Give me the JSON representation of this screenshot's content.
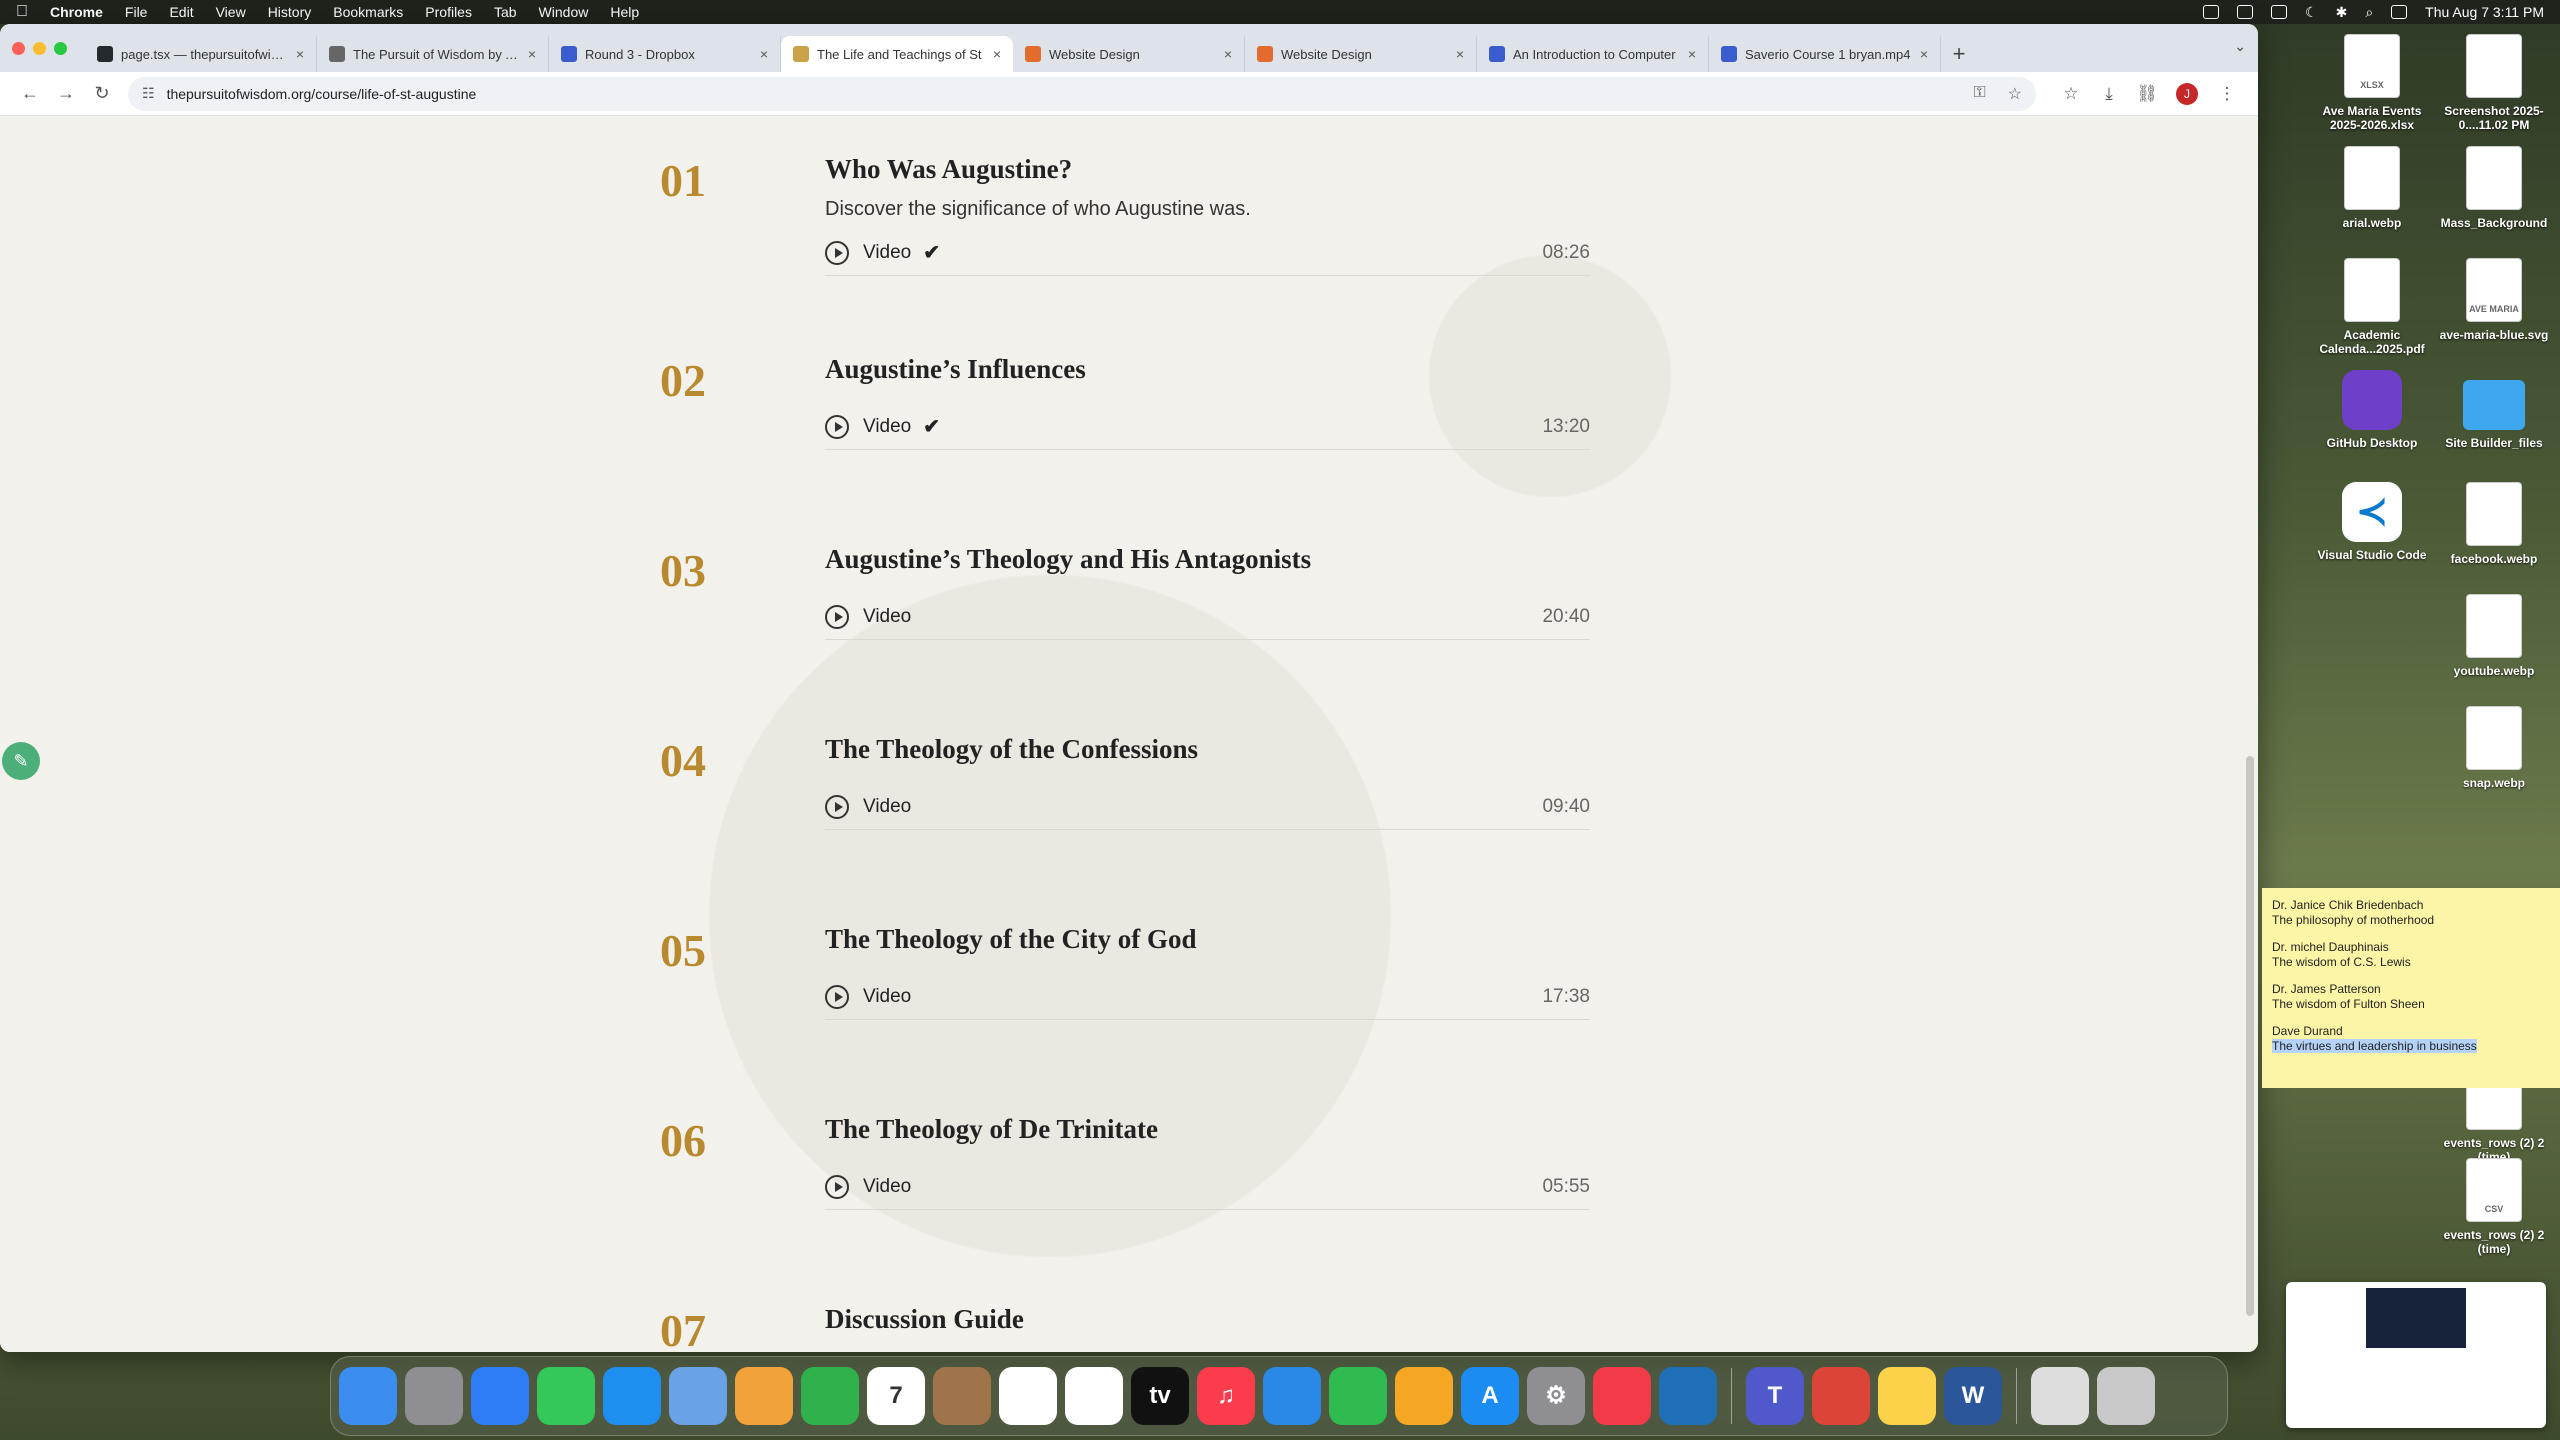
{
  "menubar": {
    "app": "Chrome",
    "items": [
      "File",
      "Edit",
      "View",
      "History",
      "Bookmarks",
      "Profiles",
      "Tab",
      "Window",
      "Help"
    ],
    "clock": "Thu Aug 7  3:11 PM"
  },
  "tabs": [
    {
      "label": "page.tsx — thepursuitofwisdom",
      "favicon": "github-icon",
      "color": "#24292e"
    },
    {
      "label": "The Pursuit of Wisdom by Ave",
      "favicon": "globe-icon",
      "color": "#666666"
    },
    {
      "label": "Round 3 - Dropbox",
      "favicon": "dropbox-icon",
      "color": "#3b5ccc"
    },
    {
      "label": "The Life and Teachings of St",
      "favicon": "site-icon",
      "color": "#c9a24a",
      "active": true
    },
    {
      "label": "Website Design",
      "favicon": "figma-icon",
      "color": "#e36b2d"
    },
    {
      "label": "Website Design",
      "favicon": "figma-icon",
      "color": "#e36b2d"
    },
    {
      "label": "An Introduction to Computer",
      "favicon": "dropbox-icon",
      "color": "#3b5ccc"
    },
    {
      "label": "Saverio Course 1 bryan.mp4",
      "favicon": "dropbox-icon",
      "color": "#3b5ccc"
    }
  ],
  "address": {
    "url": "thepursuitofwisdom.org/course/life-of-st-augustine"
  },
  "profile_initial": "J",
  "lessons": [
    {
      "num": "01",
      "title": "Who Was Augustine?",
      "desc": "Discover the significance of who Augustine was.",
      "type": "Video",
      "done": true,
      "duration": "08:26"
    },
    {
      "num": "02",
      "title": "Augustine’s Influences",
      "desc": "",
      "type": "Video",
      "done": true,
      "duration": "13:20"
    },
    {
      "num": "03",
      "title": "Augustine’s Theology and His Antagonists",
      "desc": "",
      "type": "Video",
      "done": false,
      "duration": "20:40"
    },
    {
      "num": "04",
      "title": "The Theology of the Confessions",
      "desc": "",
      "type": "Video",
      "done": false,
      "duration": "09:40"
    },
    {
      "num": "05",
      "title": "The Theology of the City of God",
      "desc": "",
      "type": "Video",
      "done": false,
      "duration": "17:38"
    },
    {
      "num": "06",
      "title": "The Theology of De Trinitate",
      "desc": "",
      "type": "Video",
      "done": false,
      "duration": "05:55"
    },
    {
      "num": "07",
      "title": "Discussion Guide",
      "desc": "",
      "type": "",
      "done": false,
      "duration": ""
    }
  ],
  "check_glyph": "✔",
  "desktop": [
    {
      "label": "Ave Maria Events 2025-2026.xlsx",
      "kind": "file",
      "badge": "XLSX"
    },
    {
      "label": "Screenshot 2025-0....11.02 PM",
      "kind": "file",
      "badge": ""
    },
    {
      "label": "arial.webp",
      "kind": "file",
      "badge": ""
    },
    {
      "label": "Mass_Background",
      "kind": "file",
      "badge": ""
    },
    {
      "label": "Academic Calenda...2025.pdf",
      "kind": "file",
      "badge": ""
    },
    {
      "label": "ave-maria-blue.svg",
      "kind": "file",
      "badge": "AVE MARIA"
    },
    {
      "label": "GitHub Desktop",
      "kind": "gh",
      "badge": ""
    },
    {
      "label": "Site Builder_files",
      "kind": "folder",
      "badge": ""
    },
    {
      "label": "Visual Studio Code",
      "kind": "vsc",
      "badge": ""
    },
    {
      "label": "facebook.webp",
      "kind": "file",
      "badge": ""
    },
    {
      "label": "youtube.webp",
      "kind": "file",
      "badge": ""
    },
    {
      "label": "snap.webp",
      "kind": "file",
      "badge": ""
    },
    {
      "label": "events_rows (2) 2 (time)",
      "kind": "file",
      "badge": ""
    },
    {
      "label": "events_rows (2) 2 (time)",
      "kind": "file",
      "badge": "CSV"
    }
  ],
  "sticky": [
    {
      "name": "Dr. Janice Chik Briedenbach",
      "topic": "The philosophy of motherhood",
      "highlight": false
    },
    {
      "name": "Dr. michel Dauphinais",
      "topic": "The wisdom of C.S. Lewis",
      "highlight": false
    },
    {
      "name": "Dr. James Patterson",
      "topic": "The wisdom of Fulton Sheen",
      "highlight": false
    },
    {
      "name": "Dave Durand",
      "topic": "The virtues and leadership in business",
      "highlight": true
    }
  ],
  "dock": [
    {
      "name": "finder-icon",
      "color": "#3b8ef0"
    },
    {
      "name": "launchpad-icon",
      "color": "#8e8e93"
    },
    {
      "name": "safari-icon",
      "color": "#2f7df6"
    },
    {
      "name": "messages-icon",
      "color": "#34c759"
    },
    {
      "name": "mail-icon",
      "color": "#1f8ef1"
    },
    {
      "name": "maps-icon",
      "color": "#6aa2e8"
    },
    {
      "name": "photos-icon",
      "color": "#f2a23a"
    },
    {
      "name": "facetime-icon",
      "color": "#30b14c"
    },
    {
      "name": "calendar-icon",
      "color": "#ffffff",
      "text": "7"
    },
    {
      "name": "contacts-icon",
      "color": "#a0744a"
    },
    {
      "name": "reminders-icon",
      "color": "#ffffff"
    },
    {
      "name": "freeform-icon",
      "color": "#ffffff"
    },
    {
      "name": "tv-icon",
      "color": "#111111",
      "text": "tv"
    },
    {
      "name": "music-icon",
      "color": "#fa3c4c",
      "text": "♫"
    },
    {
      "name": "keynote-icon",
      "color": "#2a88e6"
    },
    {
      "name": "numbers-icon",
      "color": "#2fbb4f"
    },
    {
      "name": "pages-icon",
      "color": "#f5a623"
    },
    {
      "name": "app-store-icon",
      "color": "#1c8cf2",
      "text": "A"
    },
    {
      "name": "system-settings-icon",
      "color": "#8e8e93",
      "text": "⚙"
    },
    {
      "name": "news-icon",
      "color": "#f23a48"
    },
    {
      "name": "vscode-dock-icon",
      "color": "#1f6fb8"
    },
    {
      "name": "sep",
      "color": ""
    },
    {
      "name": "teams-icon",
      "color": "#5059c9",
      "text": "T"
    },
    {
      "name": "chrome-icon",
      "color": "#db4437"
    },
    {
      "name": "notes-icon",
      "color": "#fbd34a"
    },
    {
      "name": "word-icon",
      "color": "#2b579a",
      "text": "W"
    },
    {
      "name": "sep",
      "color": ""
    },
    {
      "name": "downloads-stack-icon",
      "color": "#dddddd"
    },
    {
      "name": "trash-icon",
      "color": "#c8c8c8"
    }
  ]
}
